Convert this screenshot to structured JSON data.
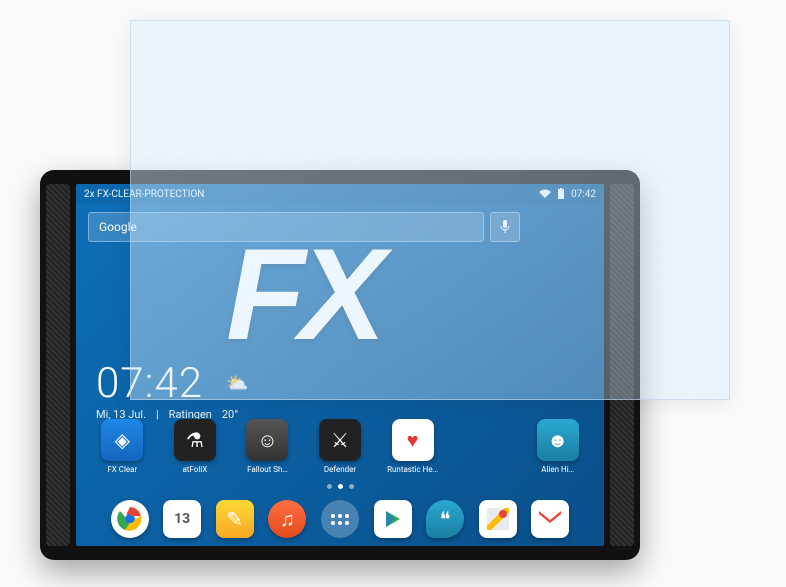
{
  "product_overlay_text": "2x FX-CLEAR-PROTECTION",
  "statusbar": {
    "left_label": "2x FX-CLEAR-PROTECTION",
    "time": "07:42"
  },
  "search": {
    "placeholder": "Google"
  },
  "fx_logo": "FX",
  "clock": {
    "time": "07:42",
    "date": "Mi, 13 Jul.",
    "location": "Ratingen",
    "temp": "20°"
  },
  "home_apps": [
    {
      "name": "fx-clear",
      "label": "FX Clear",
      "glyph": "◈",
      "bg": "bg-blue"
    },
    {
      "name": "atfolix",
      "label": "atFoliX",
      "glyph": "⚗",
      "bg": "bg-dark"
    },
    {
      "name": "fallout",
      "label": "Fallout Sh…",
      "glyph": "☺",
      "bg": "bg-gray"
    },
    {
      "name": "defender",
      "label": "Defender",
      "glyph": "⚔",
      "bg": "bg-dark"
    },
    {
      "name": "health",
      "label": "Runtastic He…",
      "glyph": "♥",
      "bg": "bg-white"
    },
    {
      "name": "app6",
      "label": "",
      "glyph": "",
      "bg": ""
    },
    {
      "name": "game",
      "label": "Alien Hi…",
      "glyph": "☻",
      "bg": "bg-teal"
    }
  ],
  "dock_apps": [
    {
      "name": "chrome",
      "glyph": "◐",
      "bg": "bg-chrome"
    },
    {
      "name": "calendar",
      "glyph": "13",
      "bg": "bg-cal"
    },
    {
      "name": "keep",
      "glyph": "✎",
      "bg": "bg-yellow"
    },
    {
      "name": "music",
      "glyph": "♫",
      "bg": "bg-orange"
    },
    {
      "name": "drawer",
      "glyph": "",
      "bg": ""
    },
    {
      "name": "play",
      "glyph": "▶",
      "bg": "bg-play"
    },
    {
      "name": "hangouts",
      "glyph": "❝",
      "bg": "bg-teal"
    },
    {
      "name": "maps",
      "glyph": "📍",
      "bg": "bg-maps"
    },
    {
      "name": "gmail",
      "glyph": "✉",
      "bg": "bg-gmail"
    }
  ]
}
